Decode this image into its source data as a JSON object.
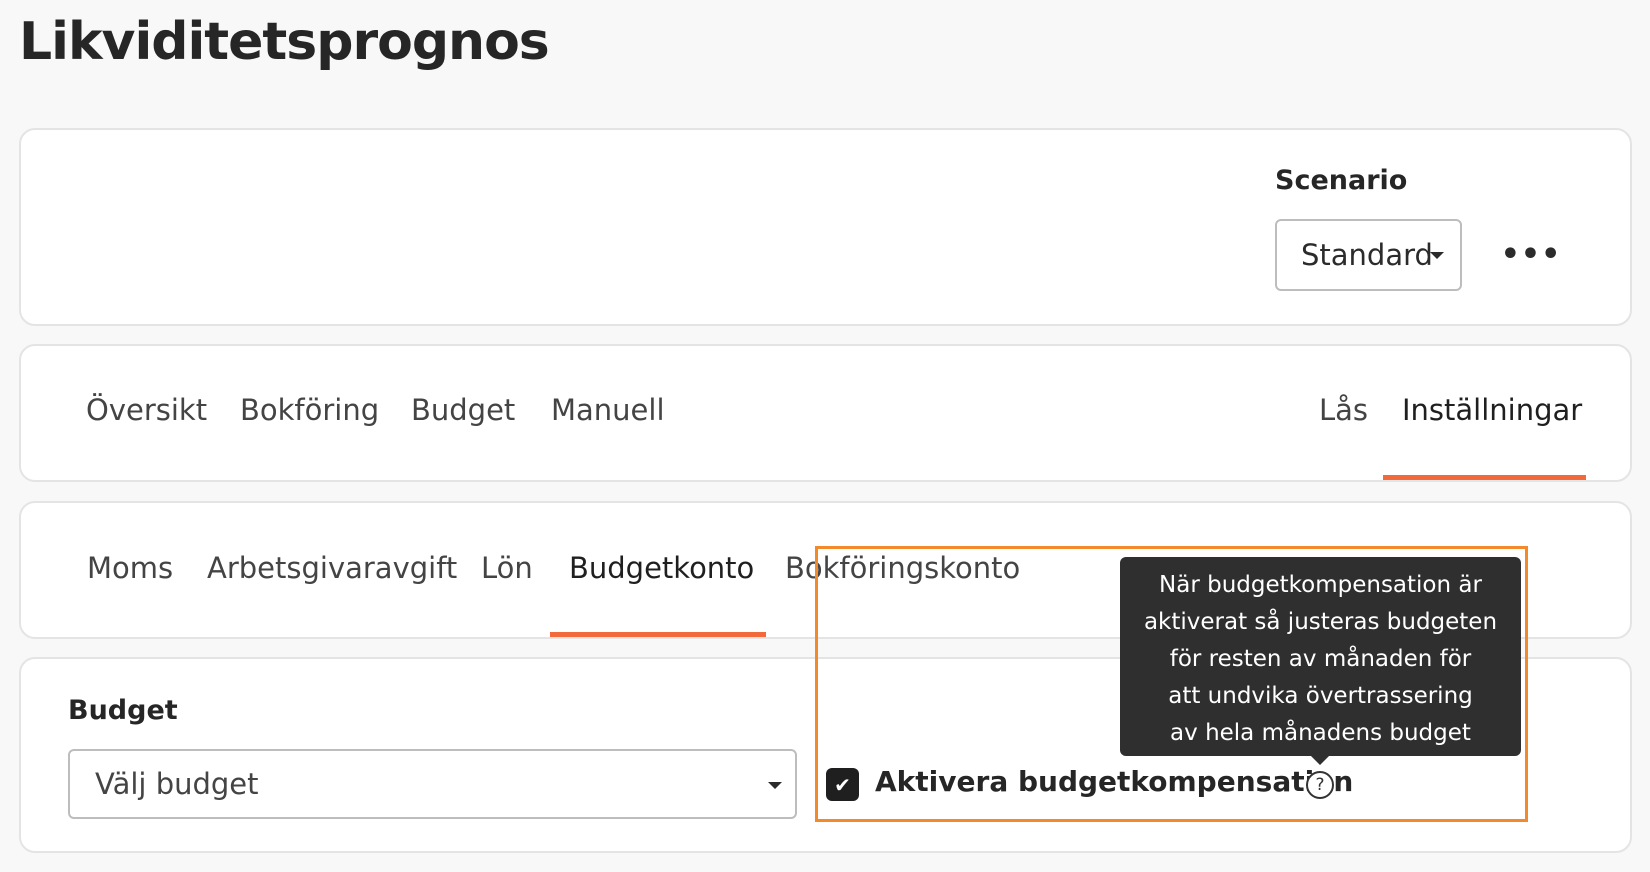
{
  "page": {
    "title": "Likviditetsprognos"
  },
  "scenario": {
    "label": "Scenario",
    "selected": "Standard",
    "more_icon": "more-horizontal-icon",
    "more_glyph": "•••"
  },
  "main_tabs": {
    "left": [
      {
        "label": "Översikt"
      },
      {
        "label": "Bokföring"
      },
      {
        "label": "Budget"
      },
      {
        "label": "Manuell"
      }
    ],
    "right": [
      {
        "label": "Lås"
      },
      {
        "label": "Inställningar",
        "active": true
      }
    ]
  },
  "sub_tabs": [
    {
      "label": "Moms"
    },
    {
      "label": "Arbetsgivaravgift"
    },
    {
      "label": "Lön"
    },
    {
      "label": "Budgetkonto",
      "active": true
    },
    {
      "label": "Bokföringskonto"
    }
  ],
  "budget": {
    "label": "Budget",
    "select_value": "Välj budget"
  },
  "compensation": {
    "checkbox_checked": true,
    "checkbox_glyph": "✔",
    "label": "Aktivera budgetkompensation",
    "help_glyph": "?",
    "tooltip_lines": [
      "När budgetkompensation är",
      "aktiverat så justeras budgeten",
      "för resten av månaden för",
      "att undvika övertrassering",
      "av hela månadens budget"
    ]
  },
  "colors": {
    "accent_underline": "#f26a3a",
    "highlight_border": "#f28a2c",
    "tooltip_bg": "#2f2f2f"
  }
}
